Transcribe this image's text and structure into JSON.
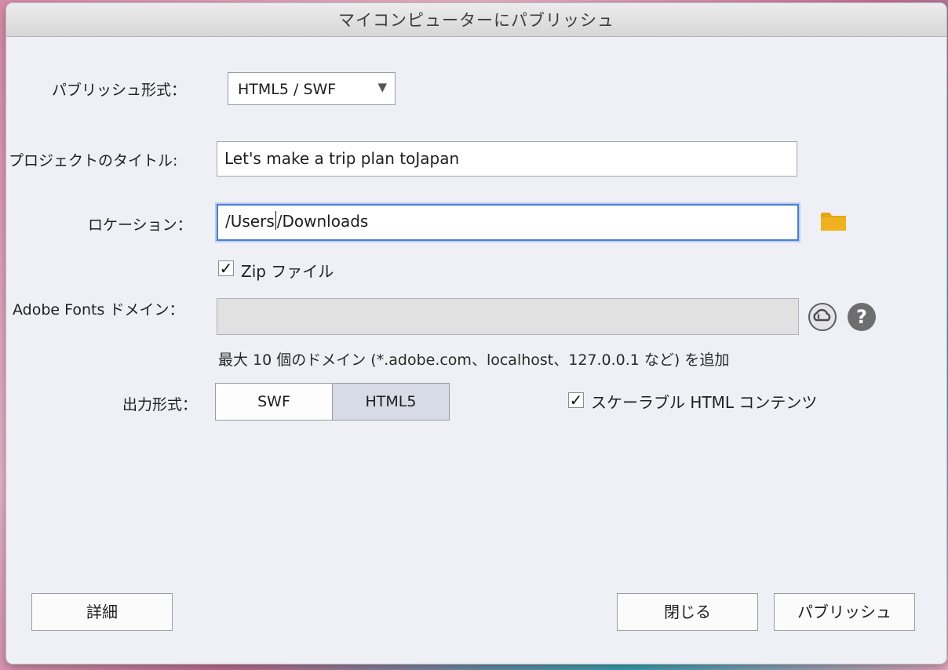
{
  "window": {
    "title": "マイコンピューターにパブリッシュ"
  },
  "form": {
    "publish_format_label": "パブリッシュ形式：",
    "publish_format_value": "HTML5 / SWF",
    "project_title_label": "プロジェクトのタイトル:",
    "project_title_value": "Let's make a trip plan toJapan",
    "location_label": "ロケーション：",
    "location_value_before_cursor": "/Users",
    "location_value_after_cursor": "/Downloads",
    "zip_label": "Zip ファイル",
    "zip_checked": true,
    "adobe_fonts_label": "Adobe Fonts ドメイン：",
    "adobe_fonts_value": "",
    "adobe_fonts_note": "最大 10 個のドメイン (*.adobe.com、localhost、127.0.0.1 など) を追加",
    "output_format_label": "出力形式：",
    "output_options": [
      "SWF",
      "HTML5"
    ],
    "output_selected": "HTML5",
    "scalable_label": "スケーラブル HTML コンテンツ",
    "scalable_checked": true
  },
  "footer": {
    "details_label": "詳細",
    "close_label": "閉じる",
    "publish_label": "パブリッシュ"
  },
  "icons": {
    "folder": "folder-icon",
    "creative_cloud": "creative-cloud-icon",
    "help": "help-icon",
    "dropdown": "chevron-down-icon"
  },
  "colors": {
    "folder": "#e8a511",
    "focus_border": "#4a7fd0",
    "selected_segment": "#d6dbe6"
  }
}
